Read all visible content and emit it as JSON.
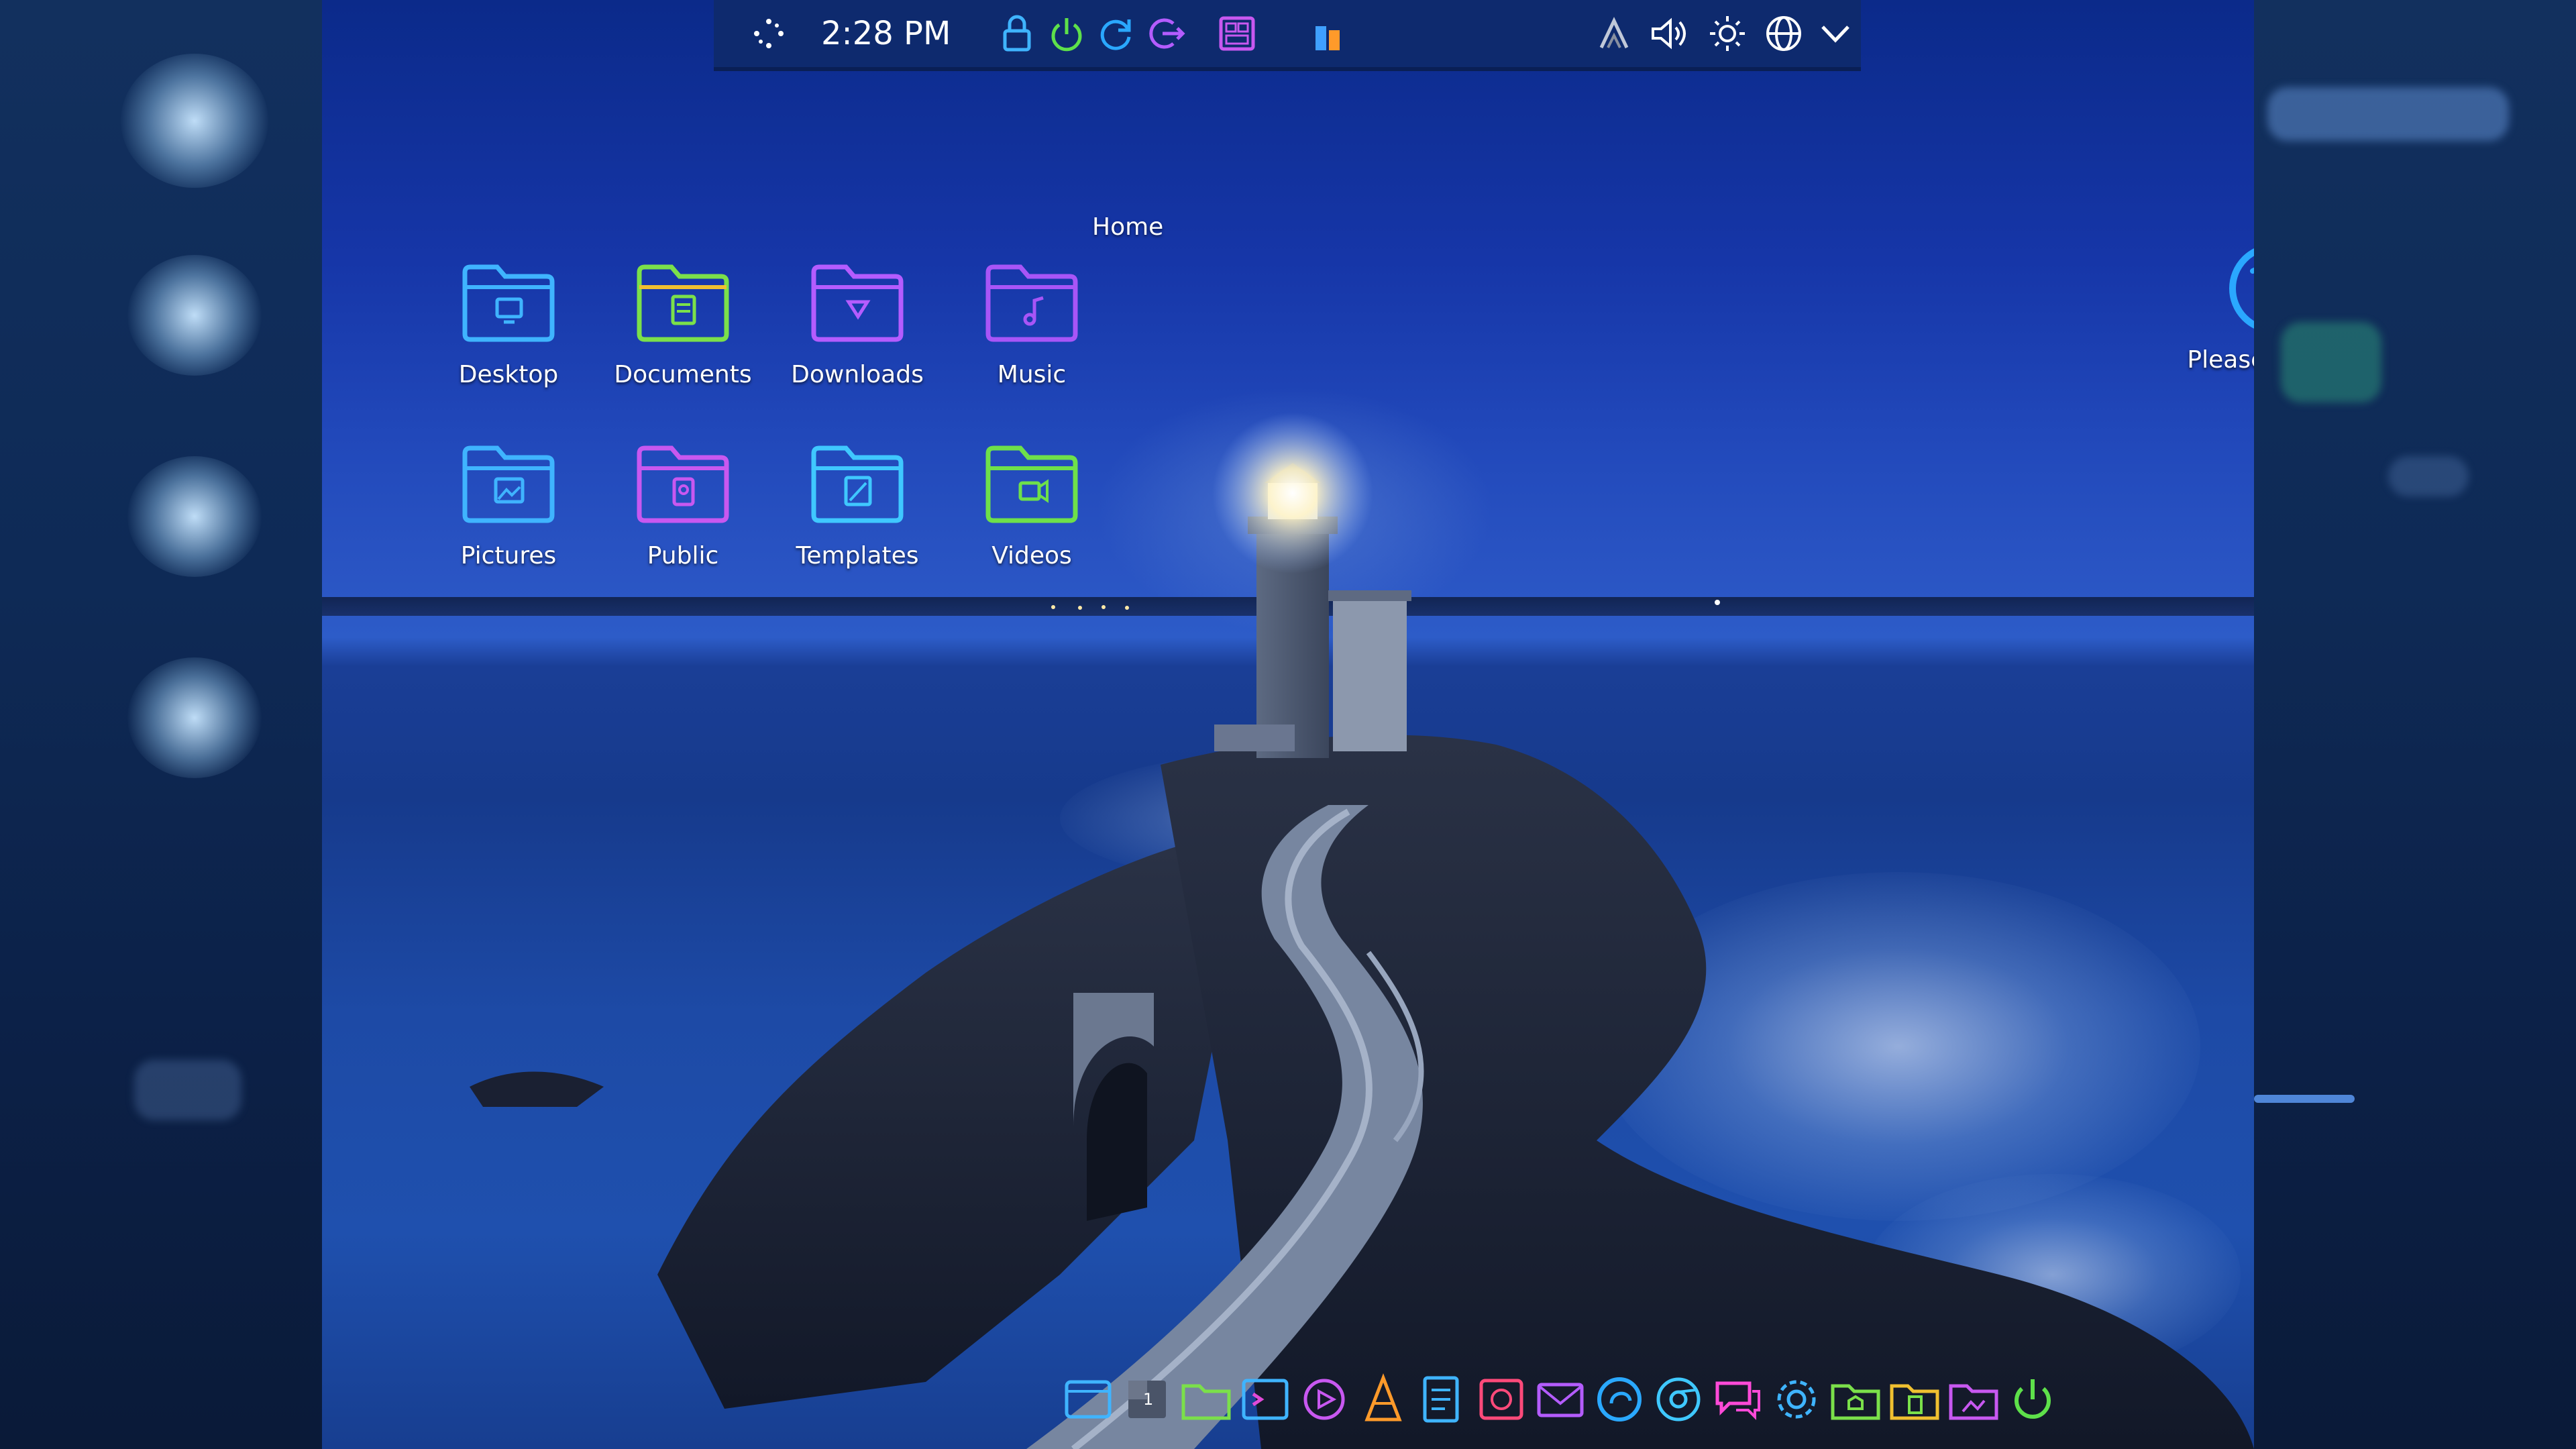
{
  "top_panel": {
    "clock": "2:28 PM",
    "icons": [
      "app-launcher-icon",
      "lock-icon",
      "power-icon",
      "restart-icon",
      "logout-icon",
      "dashboard-icon",
      "system-monitor-icon",
      "updates-icon",
      "volume-icon",
      "brightness-icon",
      "network-icon",
      "chevron-down-icon"
    ]
  },
  "desktop": {
    "group_title": "Home",
    "folders": [
      {
        "label": "Desktop",
        "color": "#3fb4ff"
      },
      {
        "label": "Documents",
        "color": "#7be04a"
      },
      {
        "label": "Downloads",
        "color": "#b45cff"
      },
      {
        "label": "Music",
        "color": "#a855f7"
      },
      {
        "label": "Pictures",
        "color": "#3fb4ff"
      },
      {
        "label": "Public",
        "color": "#c858f0"
      },
      {
        "label": "Templates",
        "color": "#3fc8ff"
      },
      {
        "label": "Videos",
        "color": "#6ee04a"
      }
    ],
    "donate_label": "Please Donate",
    "donate_color": "#2aa8ff"
  },
  "dock": {
    "items": [
      "file-manager-icon",
      "workspace-icon",
      "folder-icon",
      "terminal-icon",
      "media-player-icon",
      "vlc-icon",
      "text-editor-icon",
      "image-viewer-icon",
      "mail-icon",
      "browser-icon",
      "chromium-icon",
      "chat-icon",
      "settings-icon",
      "home-folder-icon",
      "documents-folder-icon",
      "pictures-folder-icon",
      "power-icon"
    ],
    "workspace_number": "1"
  }
}
